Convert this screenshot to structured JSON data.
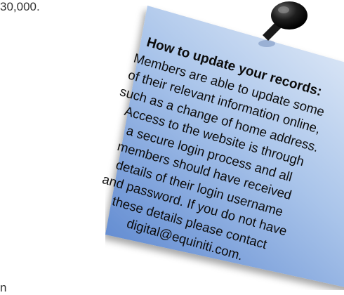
{
  "background": {
    "top_text": "30,000.",
    "bottom_text": "n"
  },
  "note": {
    "heading": "How to update your records:",
    "lines": [
      "Members are able to update some",
      "of their relevant information online,",
      "such as a change of home address.",
      "Access to the website is through",
      "a secure login process and all",
      "members should have received",
      "details of their login username",
      "and password. If you do not have",
      "these details please contact",
      "digital@equiniti.com."
    ],
    "colors": {
      "note_top": "#dfe9f7",
      "note_bottom": "#5b86cf",
      "pin": "#111111"
    }
  }
}
